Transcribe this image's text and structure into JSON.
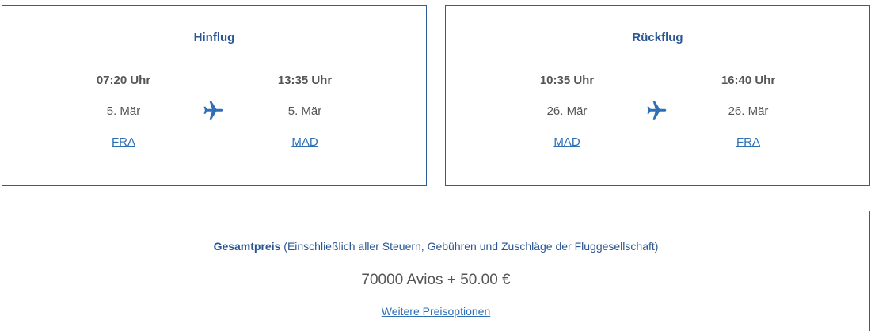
{
  "outbound": {
    "title": "Hinflug",
    "departure": {
      "time": "07:20 Uhr",
      "date": "5. Mär",
      "airport": "FRA"
    },
    "arrival": {
      "time": "13:35 Uhr",
      "date": "5. Mär",
      "airport": "MAD"
    },
    "icon": "airplane-icon"
  },
  "return": {
    "title": "Rückflug",
    "departure": {
      "time": "10:35 Uhr",
      "date": "26. Mär",
      "airport": "MAD"
    },
    "arrival": {
      "time": "16:40 Uhr",
      "date": "26. Mär",
      "airport": "FRA"
    },
    "icon": "airplane-icon"
  },
  "price": {
    "label_strong": "Gesamtpreis",
    "label_note": " (Einschließlich aller Steuern, Gebühren und Zuschläge der Fluggesellschaft)",
    "value": "70000 Avios + 50.00 €",
    "more_options_link": "Weitere Preisoptionen"
  },
  "colors": {
    "border": "#2f5e9b",
    "title": "#2a5592",
    "link": "#2f6fb5",
    "icon": "#2f6fb5",
    "text": "#555555"
  }
}
